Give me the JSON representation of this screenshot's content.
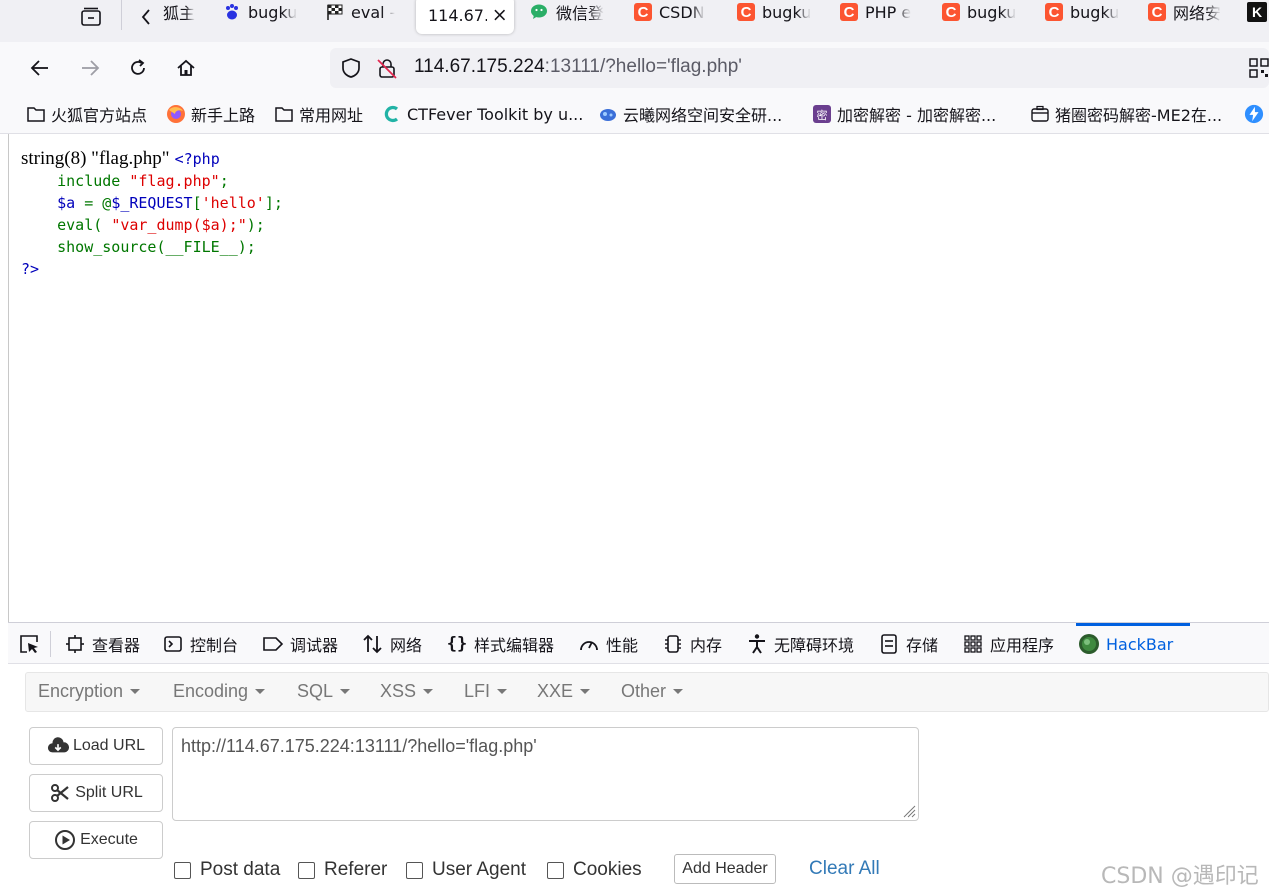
{
  "tabs": [
    {
      "label": "狐主",
      "icon": "firefox-doc-icon"
    },
    {
      "label": "bugku",
      "icon": "baidu-paw-icon"
    },
    {
      "label": "eval -",
      "icon": "checkered-flag-icon"
    },
    {
      "label": "114.67.",
      "icon": "none",
      "active": true
    },
    {
      "label": "微信登",
      "icon": "wechat-icon"
    },
    {
      "label": "CSDN",
      "icon": "csdn-icon"
    },
    {
      "label": "bugku",
      "icon": "csdn-icon"
    },
    {
      "label": "PHP e",
      "icon": "csdn-icon"
    },
    {
      "label": "bugku",
      "icon": "csdn-icon"
    },
    {
      "label": "bugku",
      "icon": "csdn-icon"
    },
    {
      "label": "网络安",
      "icon": "csdn-icon"
    },
    {
      "label": "",
      "icon": "k-logo-icon"
    }
  ],
  "csdn_glyph": "C",
  "k_glyph": "K",
  "url": {
    "host": "114.67.175.224",
    "rest": ":13111/?hello='flag.php'"
  },
  "bookmarks": [
    {
      "label": "火狐官方站点",
      "icon": "folder-icon"
    },
    {
      "label": "新手上路",
      "icon": "firefox-icon"
    },
    {
      "label": "常用网址",
      "icon": "folder-icon"
    },
    {
      "label": "CTFever Toolkit by u...",
      "icon": "ctfever-icon"
    },
    {
      "label": "云曦网络空间安全研...",
      "icon": "yunxi-icon"
    },
    {
      "label": "加密解密 - 加密解密...",
      "icon": "crypto-icon"
    },
    {
      "label": "猪圈密码解密-ME2在...",
      "icon": "pigpen-icon"
    }
  ],
  "page": {
    "var_dump": "string(8) \"flag.php\"",
    "php_open": "<?php",
    "line1_kw": "include ",
    "line1_str": "\"flag.php\"",
    "line1_end": ";",
    "line2_var": "$a",
    "line2_eq": " = @",
    "line2_req": "$_REQUEST",
    "line2_br": "[",
    "line2_str": "'hello'",
    "line2_end": "];",
    "line3_fn": "eval( ",
    "line3_str": "\"var_dump($a);\"",
    "line3_end": ");",
    "line4": "show_source(__FILE__);",
    "php_close": "?>"
  },
  "devtools": {
    "tabs": [
      {
        "label": "查看器",
        "icon": "inspector-icon"
      },
      {
        "label": "控制台",
        "icon": "console-icon"
      },
      {
        "label": "调试器",
        "icon": "debugger-icon"
      },
      {
        "label": "网络",
        "icon": "network-icon"
      },
      {
        "label": "样式编辑器",
        "icon": "style-editor-icon"
      },
      {
        "label": "性能",
        "icon": "performance-icon"
      },
      {
        "label": "内存",
        "icon": "memory-icon"
      },
      {
        "label": "无障碍环境",
        "icon": "accessibility-icon"
      },
      {
        "label": "存储",
        "icon": "storage-icon"
      },
      {
        "label": "应用程序",
        "icon": "application-icon"
      },
      {
        "label": "HackBar",
        "icon": "hackbar-icon",
        "active": true
      }
    ],
    "accent": "#0060df"
  },
  "hackbar": {
    "menu": [
      "Encryption",
      "Encoding",
      "SQL",
      "XSS",
      "LFI",
      "XXE",
      "Other"
    ],
    "load_url": "Load URL",
    "split_url": "Split URL",
    "execute": "Execute",
    "url_value": "http://114.67.175.224:13111/?hello='flag.php'",
    "checks": [
      "Post data",
      "Referer",
      "User Agent",
      "Cookies"
    ],
    "add_header": "Add Header",
    "clear_all": "Clear All"
  },
  "watermark": "CSDN @遇印记"
}
